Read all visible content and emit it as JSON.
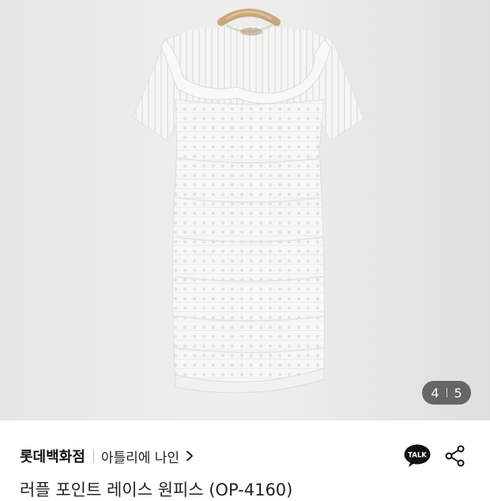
{
  "gallery": {
    "image_alt": "white lace short-sleeve dress on hanger",
    "counter_current": "4",
    "counter_total": "5"
  },
  "seller": {
    "brand": "롯데백화점",
    "shop": "아틀리에 나인"
  },
  "product": {
    "title": "러플 포인트 레이스 원피스 (OP-4160)"
  },
  "icons": {
    "talk_badge": "TALK",
    "talk": "kakaotalk-chat-icon",
    "share": "share-icon",
    "chevron": "chevron-right-icon"
  },
  "colors": {
    "background": "#ffffff",
    "photo_bg": "#e9e9e9",
    "counter_bg": "#4b4b4b",
    "talk_bubble": "#111111"
  }
}
